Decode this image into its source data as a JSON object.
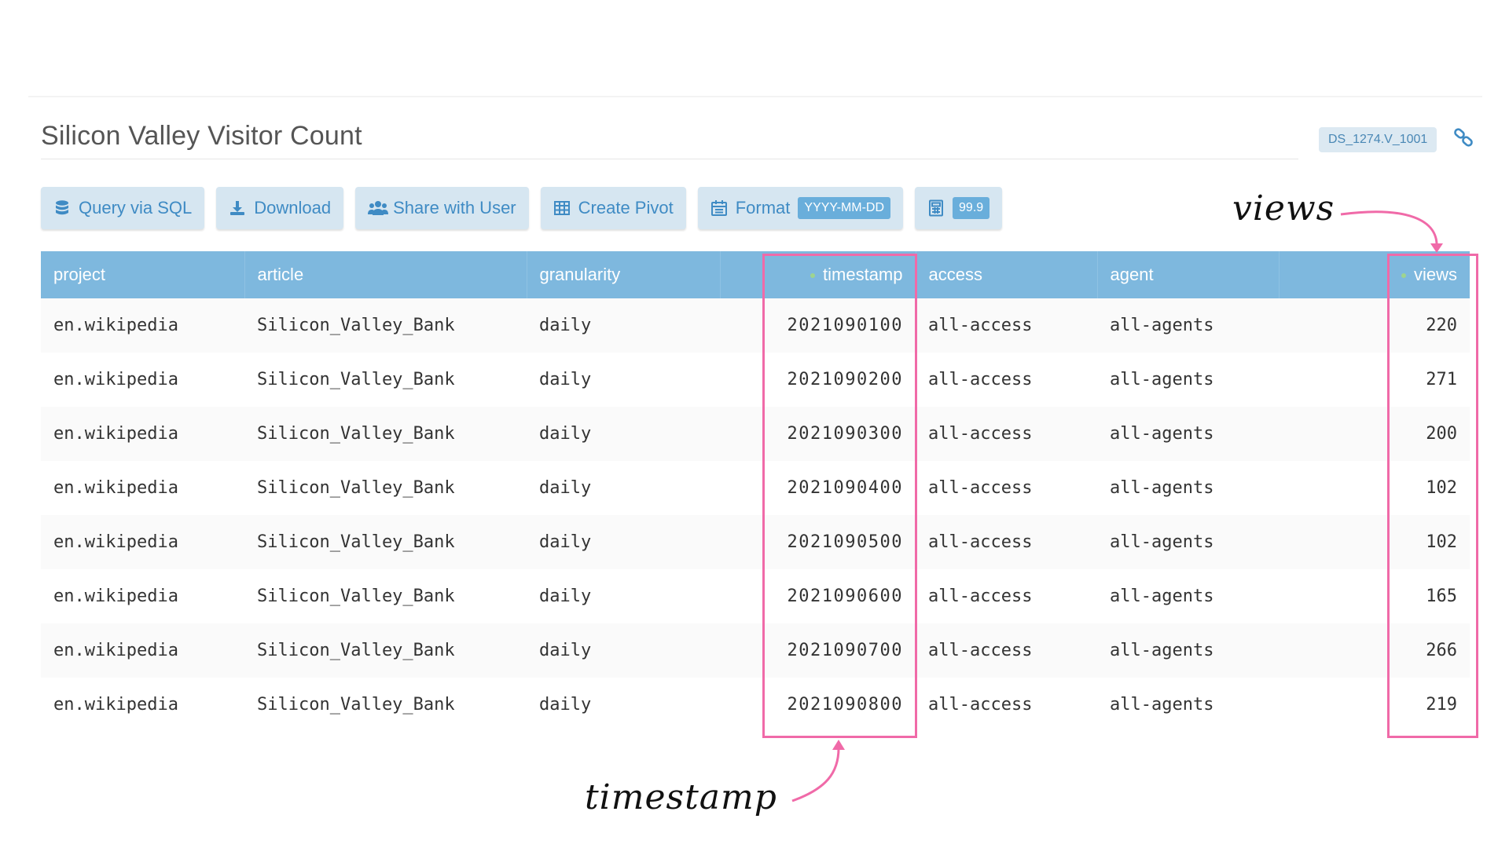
{
  "page": {
    "title": "Silicon Valley Visitor Count",
    "dataset_badge": "DS_1274.V_1001"
  },
  "toolbar": {
    "query_sql": "Query via SQL",
    "download": "Download",
    "share": "Share with User",
    "pivot": "Create Pivot",
    "format_label": "Format",
    "format_value": "YYYY-MM-DD",
    "precision_value": "99.9"
  },
  "table": {
    "columns": [
      "project",
      "article",
      "granularity",
      "timestamp",
      "access",
      "agent",
      "views"
    ],
    "rows": [
      [
        "en.wikipedia",
        "Silicon_Valley_Bank",
        "daily",
        "2021090100",
        "all-access",
        "all-agents",
        "220"
      ],
      [
        "en.wikipedia",
        "Silicon_Valley_Bank",
        "daily",
        "2021090200",
        "all-access",
        "all-agents",
        "271"
      ],
      [
        "en.wikipedia",
        "Silicon_Valley_Bank",
        "daily",
        "2021090300",
        "all-access",
        "all-agents",
        "200"
      ],
      [
        "en.wikipedia",
        "Silicon_Valley_Bank",
        "daily",
        "2021090400",
        "all-access",
        "all-agents",
        "102"
      ],
      [
        "en.wikipedia",
        "Silicon_Valley_Bank",
        "daily",
        "2021090500",
        "all-access",
        "all-agents",
        "102"
      ],
      [
        "en.wikipedia",
        "Silicon_Valley_Bank",
        "daily",
        "2021090600",
        "all-access",
        "all-agents",
        "165"
      ],
      [
        "en.wikipedia",
        "Silicon_Valley_Bank",
        "daily",
        "2021090700",
        "all-access",
        "all-agents",
        "266"
      ],
      [
        "en.wikipedia",
        "Silicon_Valley_Bank",
        "daily",
        "2021090800",
        "all-access",
        "all-agents",
        "219"
      ]
    ]
  },
  "annotations": {
    "views_note": "views",
    "timestamp_note": "timestamp",
    "highlight_color": "#f06aa8"
  },
  "colors": {
    "header_bg": "#7eb8de",
    "button_bg": "#d6e6f1",
    "button_text": "#3f8bc4"
  },
  "icons": [
    "database-icon",
    "download-icon",
    "users-icon",
    "table-icon",
    "calendar-icon",
    "calculator-icon",
    "link-icon"
  ]
}
